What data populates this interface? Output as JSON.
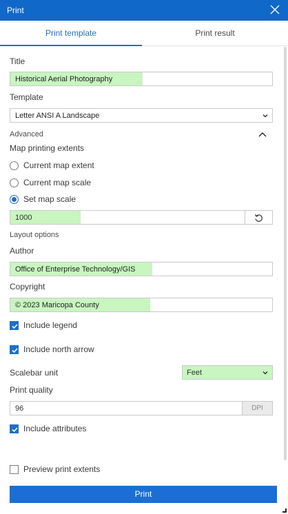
{
  "window": {
    "title": "Print"
  },
  "tabs": [
    {
      "label": "Print template"
    },
    {
      "label": "Print result"
    }
  ],
  "form": {
    "title_label": "Title",
    "title_value": "Historical Aerial Photography",
    "template_label": "Template",
    "template_value": "Letter ANSI A Landscape",
    "advanced_label": "Advanced",
    "extents_label": "Map printing extents",
    "extent_options": [
      {
        "label": "Current map extent",
        "selected": false
      },
      {
        "label": "Current map scale",
        "selected": false
      },
      {
        "label": "Set map scale",
        "selected": true
      }
    ],
    "map_scale_value": "1000",
    "layout_options_label": "Layout options",
    "author_label": "Author",
    "author_value": "Office of Enterprise Technology/GIS",
    "copyright_label": "Copyright",
    "copyright_value": "© 2023 Maricopa County",
    "include_legend_label": "Include legend",
    "include_north_arrow_label": "Include north arrow",
    "scalebar_unit_label": "Scalebar unit",
    "scalebar_unit_value": "Feet",
    "print_quality_label": "Print quality",
    "print_quality_value": "96",
    "print_quality_unit": "DPI",
    "include_attributes_label": "Include attributes",
    "preview_extents_label": "Preview print extents",
    "print_button_label": "Print"
  },
  "colors": {
    "accent": "#1f6fc5",
    "highlight": "#c8f5c0",
    "titlebar": "#1068c8"
  }
}
